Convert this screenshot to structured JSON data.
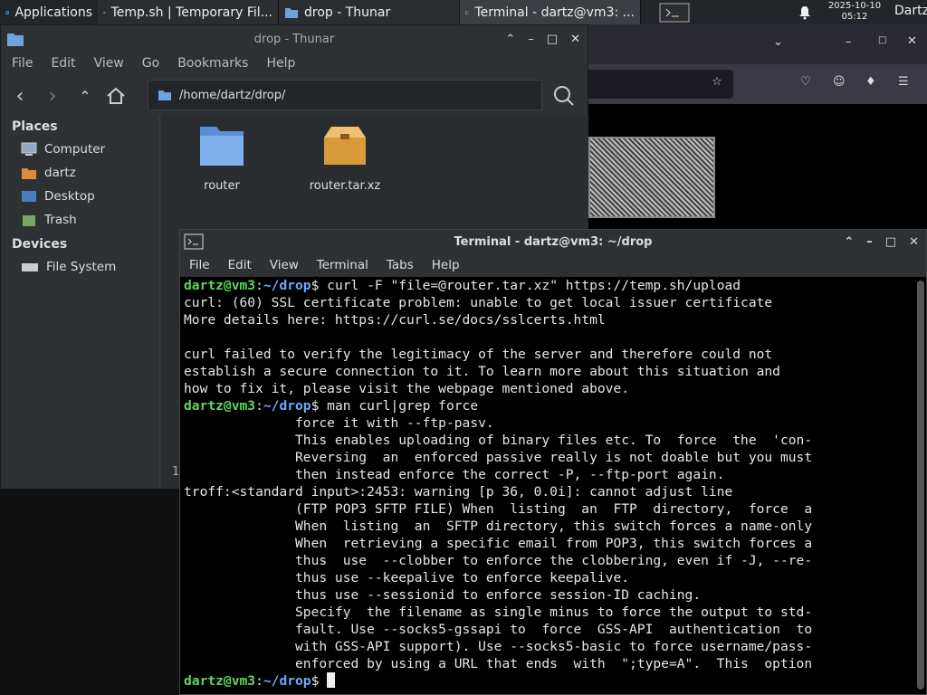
{
  "panel": {
    "applications_label": "Applications",
    "tasks": [
      {
        "label": "Temp.sh | Temporary Fil..."
      },
      {
        "label": "drop - Thunar"
      },
      {
        "label": "Terminal - dartz@vm3: ..."
      }
    ],
    "clock_date": "2025-10-10",
    "clock_time": "05:12",
    "user": "Dartz"
  },
  "thunar": {
    "title": "drop - Thunar",
    "menu": [
      "File",
      "Edit",
      "View",
      "Go",
      "Bookmarks",
      "Help"
    ],
    "location": "/home/dartz/drop/",
    "places_header": "Places",
    "places": [
      "Computer",
      "dartz",
      "Desktop",
      "Trash"
    ],
    "devices_header": "Devices",
    "devices": [
      "File System"
    ],
    "files": [
      {
        "name": "router",
        "icon": "folder-icon"
      },
      {
        "name": "router.tar.xz",
        "icon": "archive-icon"
      }
    ],
    "status_fragment": "1"
  },
  "terminal": {
    "title": "Terminal - dartz@vm3: ~/drop",
    "menu": [
      "File",
      "Edit",
      "View",
      "Terminal",
      "Tabs",
      "Help"
    ],
    "prompt_user": "dartz@vm3",
    "prompt_path": "~/drop",
    "cmd1": " curl -F \"file=@router.tar.xz\" https://temp.sh/upload",
    "out1": [
      "curl: (60) SSL certificate problem: unable to get local issuer certificate",
      "More details here: https://curl.se/docs/sslcerts.html",
      "",
      "curl failed to verify the legitimacy of the server and therefore could not",
      "establish a secure connection to it. To learn more about this situation and",
      "how to fix it, please visit the webpage mentioned above."
    ],
    "cmd2": " man curl|grep force",
    "out2": [
      "              force it with --ftp-pasv.",
      "              This enables uploading of binary files etc. To  force  the  'con-",
      "              Reversing  an  enforced passive really is not doable but you must",
      "              then instead enforce the correct -P, --ftp-port again.",
      "troff:<standard input>:2453: warning [p 36, 0.0i]: cannot adjust line",
      "              (FTP POP3 SFTP FILE) When  listing  an  FTP  directory,  force  a",
      "              When  listing  an  SFTP directory, this switch forces a name-only",
      "              When  retrieving a specific email from POP3, this switch forces a",
      "              thus  use  --clobber to enforce the clobbering, even if -J, --re-",
      "              thus use --keepalive to enforce keepalive.",
      "              thus use --sessionid to enforce session-ID caching.",
      "              Specify  the filename as single minus to force the output to std-",
      "              fault. Use --socks5-gssapi to  force  GSS-API  authentication  to",
      "              with GSS-API support). Use --socks5-basic to force username/pass-",
      "              enforced by using a URL that ends  with  \";type=A\".  This  option"
    ],
    "prompt_suffix": "$"
  },
  "colors": {
    "prompt_user": "#5fd75f",
    "prompt_path": "#6fa8ff"
  }
}
